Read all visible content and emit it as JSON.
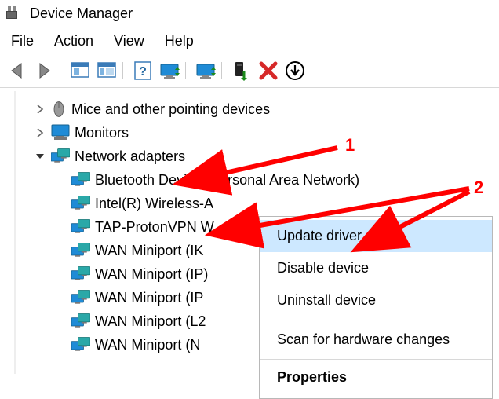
{
  "window": {
    "title": "Device Manager"
  },
  "menu": {
    "file": "File",
    "action": "Action",
    "view": "View",
    "help": "Help"
  },
  "tree": {
    "mice": {
      "label": "Mice and other pointing devices",
      "expanded": false
    },
    "monitors": {
      "label": "Monitors",
      "expanded": false
    },
    "netadapters": {
      "label": "Network adapters",
      "expanded": true,
      "children": [
        {
          "label": "Bluetooth Device (Personal Area Network)"
        },
        {
          "label": "Intel(R) Wireless-A"
        },
        {
          "label": "TAP-ProtonVPN W"
        },
        {
          "label": "WAN Miniport (IK"
        },
        {
          "label": "WAN Miniport (IP)"
        },
        {
          "label": "WAN Miniport (IP"
        },
        {
          "label": "WAN Miniport (L2"
        },
        {
          "label": "WAN Miniport (N"
        }
      ]
    }
  },
  "context_menu": {
    "update": "Update driver",
    "disable": "Disable device",
    "uninstall": "Uninstall device",
    "scan": "Scan for hardware changes",
    "properties": "Properties"
  },
  "annotations": {
    "one": "1",
    "two": "2"
  },
  "colors": {
    "highlight": "#cde8ff",
    "annotation": "#ff0000",
    "monitor_blue": "#1f8bd6",
    "monitor_teal": "#2aa8a8",
    "close_red": "#d62828"
  }
}
